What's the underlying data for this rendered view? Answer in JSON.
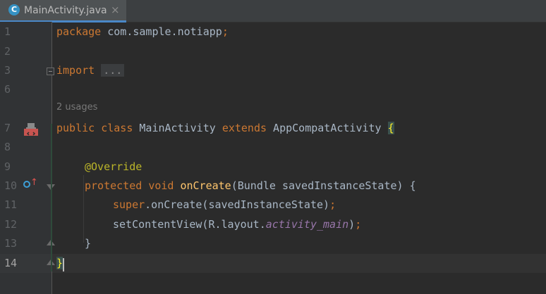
{
  "tab": {
    "icon_letter": "C",
    "title": "MainActivity.java",
    "close_glyph": "×"
  },
  "gutter": {
    "line_numbers": [
      "1",
      "2",
      "3",
      "6",
      "7",
      "8",
      "9",
      "10",
      "11",
      "12",
      "13",
      "14"
    ]
  },
  "code": {
    "line1": {
      "kw": "package",
      "rest": " com.sample.notiapp",
      "semi": ";"
    },
    "line3": {
      "kw": "import",
      "dots": "..."
    },
    "usages": "2 usages",
    "line7": {
      "kw1": "public",
      "kw2": "class",
      "name": " MainActivity ",
      "kw3": "extends",
      "parent": " AppCompatActivity ",
      "brace": "{"
    },
    "line9": {
      "annotation": "@Override"
    },
    "line10": {
      "kw1": "protected",
      "kw2": "void",
      "fn": "onCreate",
      "rest": "(Bundle savedInstanceState) {"
    },
    "line11": {
      "kw": "super",
      "rest": ".onCreate(savedInstanceState)",
      "semi": ";"
    },
    "line12": {
      "pre": "setContentView(R.layout.",
      "it": "activity_main",
      "post": ")",
      "semi": ";"
    },
    "line13": {
      "brace": "}"
    },
    "line14": {
      "brace": "}"
    }
  },
  "colors": {
    "keyword": "#cc7832",
    "annotation": "#bbb529",
    "function": "#ffc66d",
    "field": "#9876aa",
    "text": "#a9b7c6"
  }
}
